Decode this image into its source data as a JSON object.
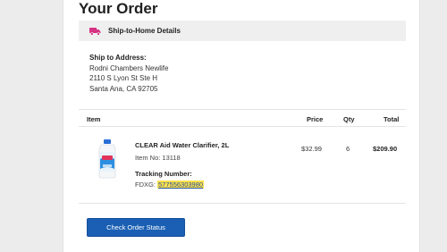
{
  "header": {
    "title": "Your Order"
  },
  "shipping": {
    "method_label": "Ship-to-Home Details",
    "address_heading": "Ship to Address:",
    "name": "Rodni Chambers Newlife",
    "street": "2110 S Lyon St Ste H",
    "city_state_zip": "Santa Ana, CA 92705"
  },
  "table": {
    "columns": {
      "item": "Item",
      "price": "Price",
      "qty": "Qty",
      "total": "Total"
    }
  },
  "order_item": {
    "name": "CLEAR Aid Water Clarifier, 2L",
    "item_no": "Item No: 13118",
    "price": "$32.99",
    "qty": "6",
    "total": "$209.90",
    "tracking_heading": "Tracking Number:",
    "tracking_prefix": "FDXG: ",
    "tracking_number": "577556303980"
  },
  "actions": {
    "check_status_label": "Check Order Status"
  },
  "colors": {
    "button": "#1a5fb4",
    "highlight": "#ffe14d",
    "truck_icon": "#d63384"
  },
  "icons": {
    "shipping": "truck-icon"
  }
}
